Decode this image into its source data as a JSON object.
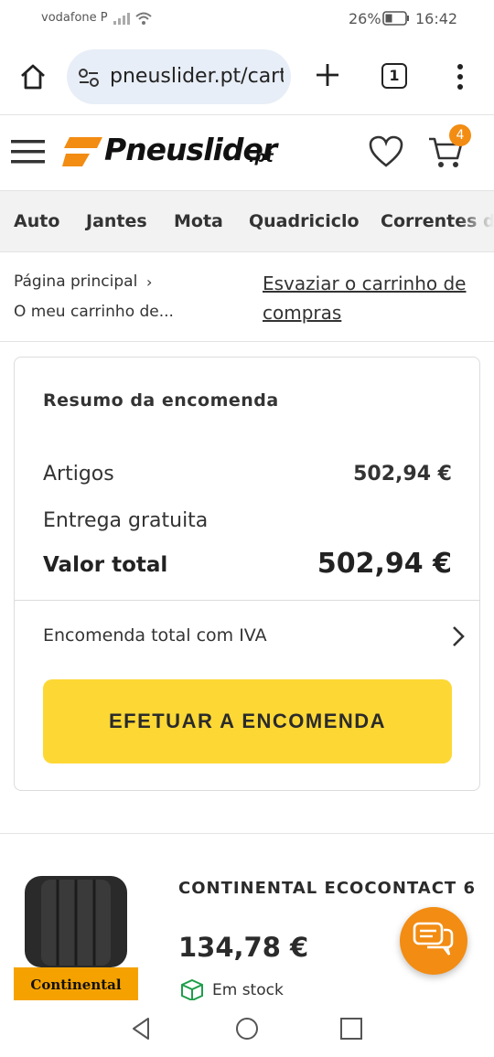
{
  "status_bar": {
    "carrier": "vodafone P",
    "battery": "26%",
    "time": "16:42"
  },
  "browser": {
    "url": "pneuslider.pt/cart",
    "tab_count": "1"
  },
  "site": {
    "logo": "Pneuslider",
    "logo_suffix": ".pt",
    "cart_count": "4",
    "accent_color": "#f28c13"
  },
  "categories": [
    "Auto",
    "Jantes",
    "Mota",
    "Quadriciclo",
    "Correntes de neve"
  ],
  "breadcrumb": {
    "home": "Página principal",
    "current": "O meu carrinho de...",
    "empty_cart": "Esvaziar o carrinho de compras"
  },
  "summary": {
    "title": "Resumo da encomenda",
    "items_label": "Artigos",
    "items_value": "502,94 €",
    "shipping_label": "Entrega gratuita",
    "total_label": "Valor total",
    "total_value": "502,94 €",
    "vat_label": "Encomenda total com IVA",
    "order_button": "EFETUAR A ENCOMENDA",
    "button_color": "#fdd835"
  },
  "product": {
    "name": "CONTINENTAL ECOCONTACT 6",
    "price": "134,78 €",
    "stock": "Em stock",
    "brand_logo": "Continental"
  }
}
